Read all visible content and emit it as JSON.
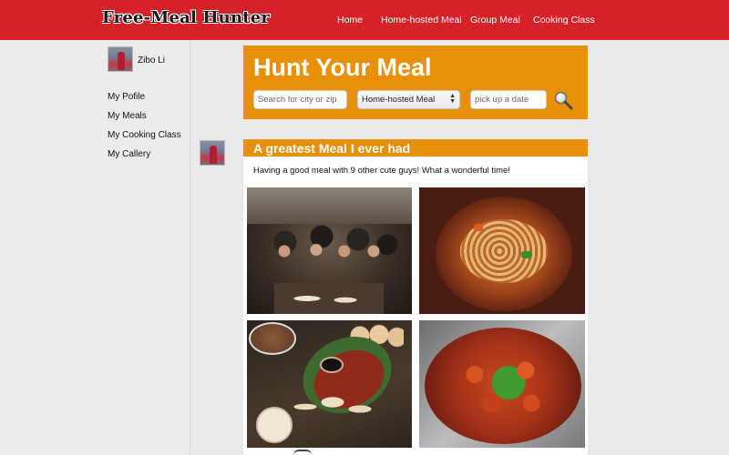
{
  "header": {
    "logo": "Free-Meal Hunter",
    "nav": [
      "Home",
      "Home-hosted Meal",
      "Group Meal",
      "Cooking Class"
    ]
  },
  "sidebar": {
    "user_name": "Zibo Li",
    "links": [
      "My Pofile",
      "My Meals",
      "My Cooking Class",
      "My Callery"
    ]
  },
  "search": {
    "title": "Hunt Your Meal",
    "location_placeholder": "Search for city or zip",
    "meal_type_selected": "Home-hosted Meal",
    "date_placeholder": "pick up a date",
    "search_icon": "magnifier-icon"
  },
  "post": {
    "title": "A greatest Meal I ever had",
    "text": "Having a good meal with 9 other cute guys! What a wonderful time!",
    "photos": [
      "group-dinner-photo",
      "noodle-soup-photo",
      "dumplings-photo",
      "spicy-chicken-photo"
    ]
  },
  "colors": {
    "brand_red": "#d42228",
    "accent_orange": "#e8900a"
  }
}
